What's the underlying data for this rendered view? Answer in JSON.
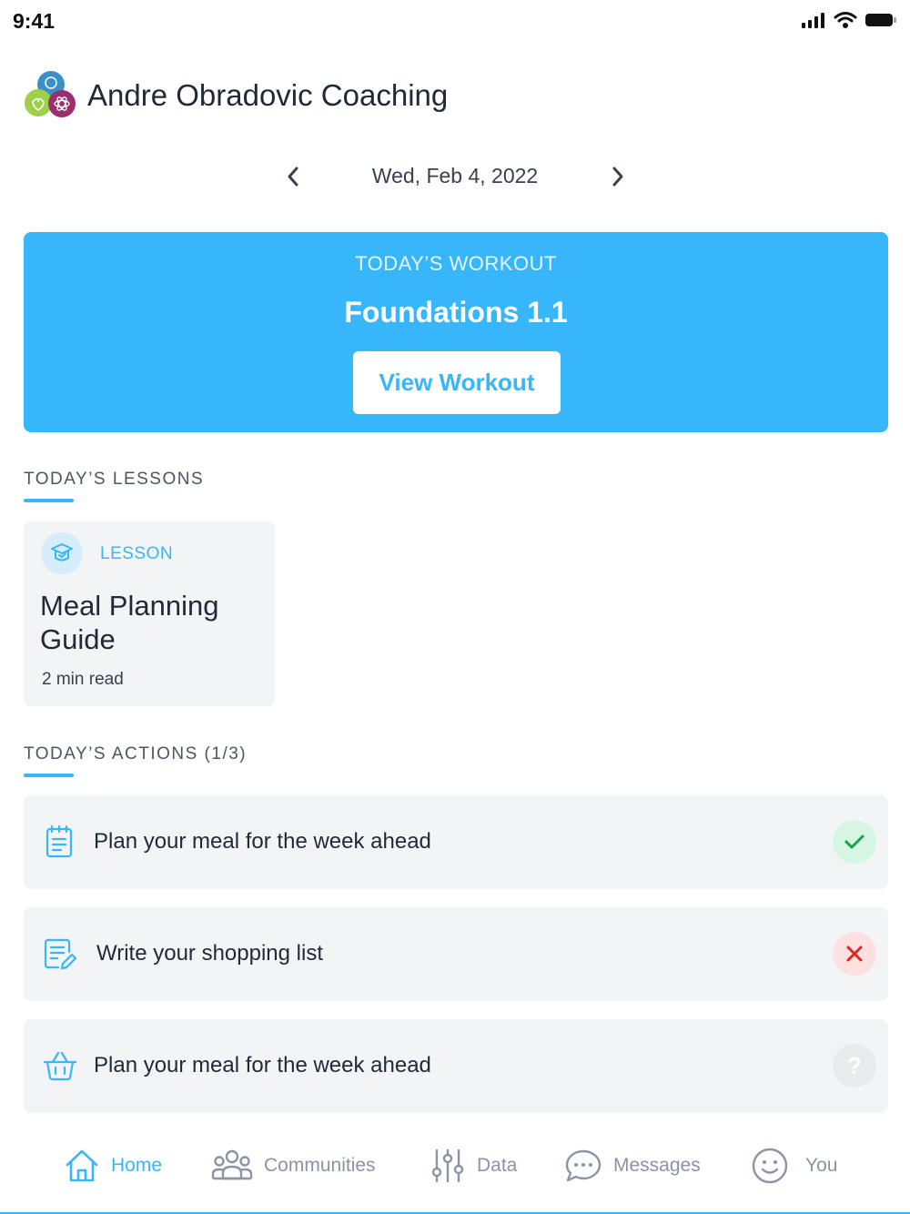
{
  "status_bar": {
    "time": "9:41"
  },
  "header": {
    "title": "Andre Obradovic Coaching"
  },
  "date_nav": {
    "date": "Wed, Feb 4, 2022"
  },
  "workout": {
    "label": "TODAY’S WORKOUT",
    "title": "Foundations 1.1",
    "button_label": "View Workout"
  },
  "lessons": {
    "heading": "TODAY’S LESSONS",
    "items": [
      {
        "type": "LESSON",
        "title": "Meal Planning Guide",
        "meta": "2 min read"
      }
    ]
  },
  "actions": {
    "heading": "TODAY’S ACTIONS (1/3)",
    "items": [
      {
        "label": "Plan your meal for the week ahead",
        "icon": "notepad-icon",
        "status": "done"
      },
      {
        "label": "Write your shopping list",
        "icon": "list-edit-icon",
        "status": "failed"
      },
      {
        "label": "Plan your meal for the week ahead",
        "icon": "basket-icon",
        "status": "pending",
        "status_glyph": "?"
      }
    ]
  },
  "tabs": [
    {
      "label": "Home",
      "icon": "home-icon",
      "active": true
    },
    {
      "label": "Communities",
      "icon": "people-icon",
      "active": false
    },
    {
      "label": "Data",
      "icon": "sliders-icon",
      "active": false
    },
    {
      "label": "Messages",
      "icon": "chat-bubble-icon",
      "active": false
    },
    {
      "label": "You",
      "icon": "smiley-icon",
      "active": false
    }
  ],
  "colors": {
    "accent": "#38b6fb",
    "success": "#16a34a",
    "danger": "#dc2626",
    "card_bg": "#f3f4f6"
  }
}
